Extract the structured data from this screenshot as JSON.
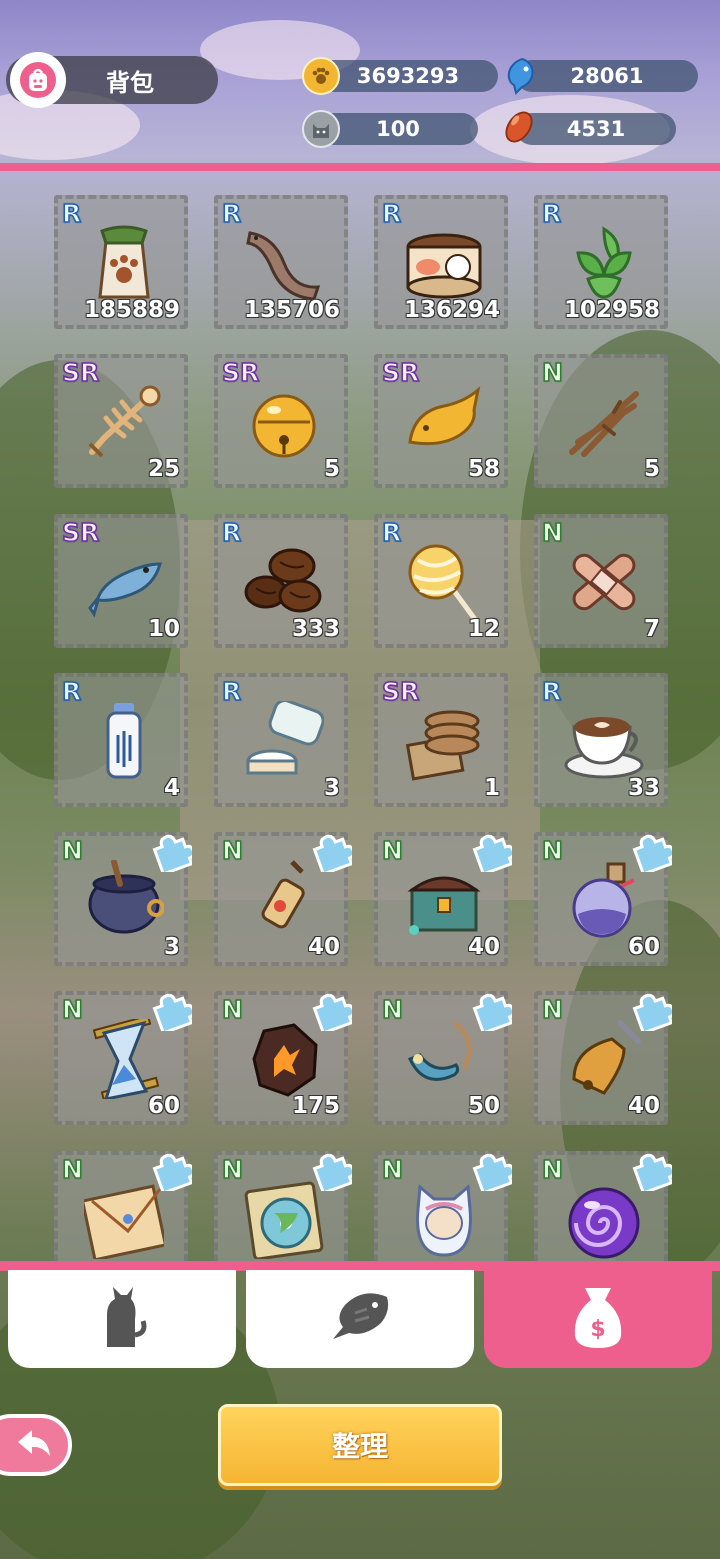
{
  "header": {
    "title": "背包",
    "bag_icon": "backpack-icon",
    "currencies": [
      {
        "name": "paw-coin",
        "icon": "paw-icon",
        "value": "3693293",
        "color": "#f2b632"
      },
      {
        "name": "fish-gem",
        "icon": "blue-fish-icon",
        "value": "28061",
        "color": "#3f95e0"
      },
      {
        "name": "cat-token",
        "icon": "cat-head-icon",
        "value": "100",
        "color": "#9aa1a6"
      },
      {
        "name": "bean",
        "icon": "bean-icon",
        "value": "4531",
        "color": "#d9562b"
      }
    ]
  },
  "items": [
    {
      "rarity": "R",
      "count": "185889",
      "icon": "paw-sack-icon"
    },
    {
      "rarity": "R",
      "count": "135706",
      "icon": "dried-fish-icon"
    },
    {
      "rarity": "R",
      "count": "136294",
      "icon": "cat-food-can-icon"
    },
    {
      "rarity": "R",
      "count": "102958",
      "icon": "catnip-leaves-icon"
    },
    {
      "rarity": "SR",
      "count": "25",
      "icon": "fish-bone-icon"
    },
    {
      "rarity": "SR",
      "count": "5",
      "icon": "golden-bell-icon"
    },
    {
      "rarity": "SR",
      "count": "58",
      "icon": "golden-fish-icon"
    },
    {
      "rarity": "N",
      "count": "5",
      "icon": "twigs-icon"
    },
    {
      "rarity": "SR",
      "count": "10",
      "icon": "blue-fish-icon"
    },
    {
      "rarity": "R",
      "count": "333",
      "icon": "coffee-beans-icon"
    },
    {
      "rarity": "R",
      "count": "12",
      "icon": "lollipop-icon"
    },
    {
      "rarity": "N",
      "count": "7",
      "icon": "bandage-icon"
    },
    {
      "rarity": "R",
      "count": "4",
      "icon": "lotion-bottle-icon"
    },
    {
      "rarity": "R",
      "count": "3",
      "icon": "cream-jar-icon"
    },
    {
      "rarity": "SR",
      "count": "1",
      "icon": "cookie-stack-icon"
    },
    {
      "rarity": "R",
      "count": "33",
      "icon": "latte-cup-icon"
    },
    {
      "rarity": "N",
      "count": "3",
      "icon": "cauldron-icon",
      "puzzle": true
    },
    {
      "rarity": "N",
      "count": "40",
      "icon": "lantern-icon",
      "puzzle": true
    },
    {
      "rarity": "N",
      "count": "40",
      "icon": "treasure-chest-icon",
      "puzzle": true
    },
    {
      "rarity": "N",
      "count": "60",
      "icon": "potion-flask-icon",
      "puzzle": true
    },
    {
      "rarity": "N",
      "count": "60",
      "icon": "hourglass-icon",
      "puzzle": true
    },
    {
      "rarity": "N",
      "count": "175",
      "icon": "lava-rock-icon",
      "puzzle": true
    },
    {
      "rarity": "N",
      "count": "50",
      "icon": "horn-necklace-icon",
      "puzzle": true
    },
    {
      "rarity": "N",
      "count": "40",
      "icon": "bell-handle-icon",
      "puzzle": true
    },
    {
      "rarity": "N",
      "count": "",
      "icon": "letter-envelope-icon",
      "puzzle": true
    },
    {
      "rarity": "N",
      "count": "",
      "icon": "map-disc-icon",
      "puzzle": true
    },
    {
      "rarity": "N",
      "count": "",
      "icon": "cat-capsule-icon",
      "puzzle": true
    },
    {
      "rarity": "N",
      "count": "",
      "icon": "purple-orb-icon",
      "puzzle": true
    }
  ],
  "tabs": [
    {
      "name": "cats",
      "icon": "cat-silhouette-icon",
      "active": false
    },
    {
      "name": "fish",
      "icon": "fish-silhouette-icon",
      "active": false
    },
    {
      "name": "bag",
      "icon": "money-bag-icon",
      "active": true
    }
  ],
  "actions": {
    "back_icon": "back-arrow-icon",
    "sort_label": "整理"
  }
}
